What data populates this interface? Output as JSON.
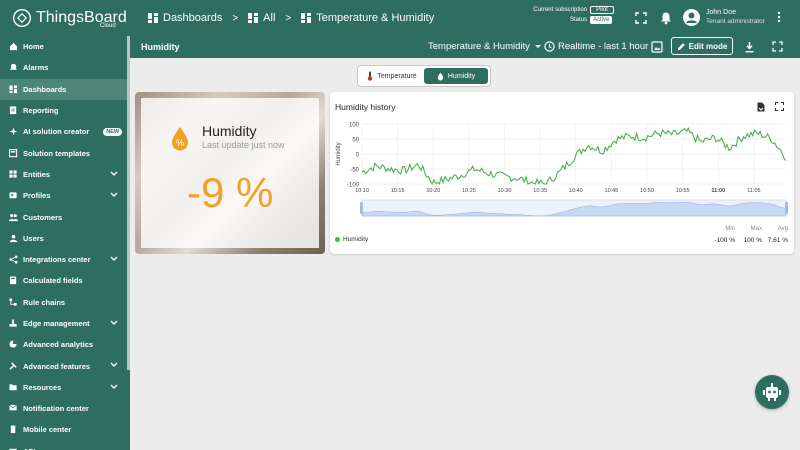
{
  "app": {
    "brand": "ThingsBoard",
    "brand_sub": "Cloud"
  },
  "breadcrumb": {
    "items": [
      "Dashboards",
      "All",
      "Temperature & Humidity"
    ],
    "separator": ">"
  },
  "subscription": {
    "label": "Current subscription",
    "plan": "Pilot",
    "status_label": "Status",
    "status": "Active"
  },
  "user": {
    "name": "John Doe",
    "role": "Tenant administrator"
  },
  "sidebar": {
    "items": [
      {
        "label": "Home",
        "icon": "home-icon",
        "chevron": false
      },
      {
        "label": "Alarms",
        "icon": "alarm-icon",
        "chevron": false
      },
      {
        "label": "Dashboards",
        "icon": "dashboard-icon",
        "chevron": false,
        "active": true
      },
      {
        "label": "Reporting",
        "icon": "report-icon",
        "chevron": false
      },
      {
        "label": "AI solution creator",
        "icon": "sparkle-icon",
        "chevron": false,
        "badge": "NEW"
      },
      {
        "label": "Solution templates",
        "icon": "template-icon",
        "chevron": false
      },
      {
        "label": "Entities",
        "icon": "entities-icon",
        "chevron": true
      },
      {
        "label": "Profiles",
        "icon": "profiles-icon",
        "chevron": true
      },
      {
        "label": "Customers",
        "icon": "customers-icon",
        "chevron": false
      },
      {
        "label": "Users",
        "icon": "users-icon",
        "chevron": false
      },
      {
        "label": "Integrations center",
        "icon": "integrations-icon",
        "chevron": true
      },
      {
        "label": "Calculated fields",
        "icon": "calc-icon",
        "chevron": false
      },
      {
        "label": "Rule chains",
        "icon": "rule-chain-icon",
        "chevron": false
      },
      {
        "label": "Edge management",
        "icon": "edge-icon",
        "chevron": true
      },
      {
        "label": "Advanced analytics",
        "icon": "analytics-icon",
        "chevron": false
      },
      {
        "label": "Advanced features",
        "icon": "tools-icon",
        "chevron": true
      },
      {
        "label": "Resources",
        "icon": "folder-icon",
        "chevron": true
      },
      {
        "label": "Notification center",
        "icon": "notification-icon",
        "chevron": false
      },
      {
        "label": "Mobile center",
        "icon": "mobile-icon",
        "chevron": false
      },
      {
        "label": "API usage",
        "icon": "api-icon",
        "chevron": false
      }
    ]
  },
  "dashboard": {
    "title": "Humidity",
    "state": "Temperature & Humidity",
    "timewindow": "Realtime - last 1 hour",
    "edit_label": "Edit mode"
  },
  "tabs": [
    {
      "label": "Temperature",
      "icon": "thermometer-icon",
      "selected": false
    },
    {
      "label": "Humidity",
      "icon": "water-drop-icon",
      "selected": true
    }
  ],
  "humidity_card": {
    "label": "Humidity",
    "subtitle": "Last update just now",
    "value": "-9 %"
  },
  "history": {
    "title": "Humidity history",
    "legend_series": "Humidity",
    "stats": {
      "headers": [
        "Min",
        "Max",
        "Avg"
      ],
      "values": [
        "-100 %",
        "100 %",
        "7.61 %"
      ]
    }
  },
  "colors": {
    "primary": "#2e6e5e",
    "accent": "#f4a025",
    "series": "#4caf50"
  },
  "chart_data": {
    "type": "line",
    "title": "Humidity history",
    "ylabel": "Humidity",
    "ylim": [
      -100,
      100
    ],
    "yticks": [
      "100",
      "50",
      "0",
      "-50",
      "-100"
    ],
    "xticks": [
      "10:10",
      "10:15",
      "10:20",
      "10:25",
      "10:30",
      "10:35",
      "10:40",
      "10:45",
      "10:50",
      "10:55",
      "11:00",
      "11:05"
    ],
    "series": [
      {
        "name": "Humidity",
        "x": [
          "10:10",
          "10:12",
          "10:14",
          "10:16",
          "10:18",
          "10:20",
          "10:22",
          "10:24",
          "10:26",
          "10:28",
          "10:30",
          "10:32",
          "10:34",
          "10:36",
          "10:38",
          "10:40",
          "10:42",
          "10:44",
          "10:46",
          "10:48",
          "10:50",
          "10:52",
          "10:54",
          "10:56",
          "10:58",
          "11:00",
          "11:02",
          "11:04",
          "11:06",
          "11:08",
          "11:10"
        ],
        "values": [
          -60,
          -40,
          -50,
          -55,
          -35,
          -95,
          -85,
          -70,
          -50,
          -65,
          -75,
          -80,
          -95,
          -100,
          -60,
          -10,
          30,
          10,
          50,
          60,
          55,
          70,
          65,
          75,
          40,
          55,
          20,
          60,
          70,
          50,
          -10
        ]
      }
    ],
    "legend": "bottom-left",
    "grid": true
  }
}
